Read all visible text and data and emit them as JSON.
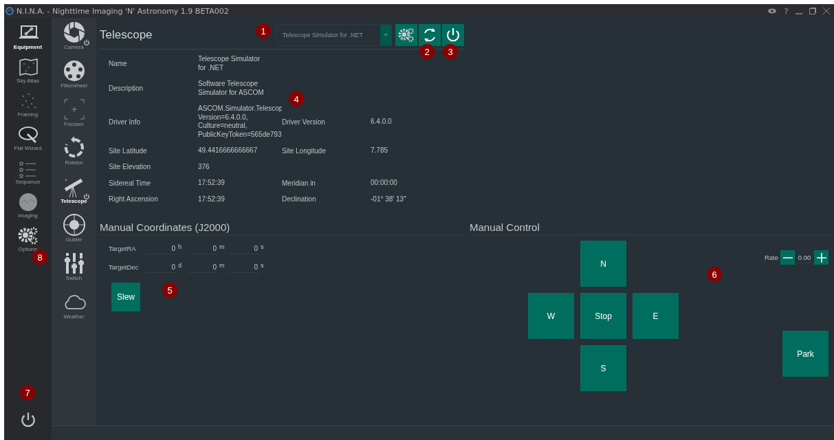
{
  "window": {
    "title": "N.I.N.A. - Nighttime Imaging 'N' Astronomy 1.9 BETA002",
    "help": "?"
  },
  "main_nav": [
    {
      "label": "Equipment",
      "selected": true
    },
    {
      "label": "Sky Atlas",
      "selected": false
    },
    {
      "label": "Framing",
      "selected": false
    },
    {
      "label": "Flat Wizard",
      "selected": false
    },
    {
      "label": "Sequence",
      "selected": false
    },
    {
      "label": "Imaging",
      "selected": false
    },
    {
      "label": "Options",
      "selected": false
    }
  ],
  "device_nav": [
    {
      "label": "Camera",
      "selected": false,
      "connected": true
    },
    {
      "label": "Filterwheel",
      "selected": false,
      "connected": false
    },
    {
      "label": "Focuser",
      "selected": false,
      "connected": false
    },
    {
      "label": "Rotator",
      "selected": false,
      "connected": false
    },
    {
      "label": "Telescope",
      "selected": true,
      "connected": true
    },
    {
      "label": "Guider",
      "selected": false,
      "connected": false
    },
    {
      "label": "Switch",
      "selected": false,
      "connected": false
    },
    {
      "label": "Weather",
      "selected": false,
      "connected": false
    }
  ],
  "telescope": {
    "title": "Telescope",
    "device_dropdown": {
      "value": "Telescope Simulator for .NET",
      "disabled": true
    },
    "info": [
      {
        "label": "Name",
        "value": [
          "Telescope Simulator",
          "for .NET"
        ]
      },
      {
        "label": "Description",
        "value": [
          "Software Telescope",
          "Simulator for ASCOM"
        ]
      },
      {
        "label": "Driver Info",
        "value": [
          "ASCOM.Simulator.Telescop",
          "Version=6.4.0.0,",
          "Culture=neutral,",
          "PublicKeyToken=565de793"
        ],
        "second": {
          "label": "Driver Version",
          "value": "6.4.0.0"
        }
      },
      {
        "label": "Site Latitude",
        "value": [
          "49.4416666666667"
        ],
        "second": {
          "label": "Site Longitude",
          "value": "7.785"
        }
      },
      {
        "label": "Site Elevation",
        "value": [
          "376"
        ]
      },
      {
        "label": "Sidereal Time",
        "value": [
          "17:52:39"
        ],
        "second": {
          "label": "Meridian in",
          "value": "00:00:00"
        }
      },
      {
        "label": "Right Ascension",
        "value": [
          "17:52:39"
        ],
        "second": {
          "label": "Declination",
          "value": "-01° 38' 13\""
        }
      }
    ]
  },
  "manual_coordinates": {
    "title": "Manual Coordinates (J2000)",
    "rows": [
      {
        "label": "TargetRA",
        "fields": [
          {
            "value": "0",
            "unit": "h"
          },
          {
            "value": "0",
            "unit": "m"
          },
          {
            "value": "0",
            "unit": "s"
          }
        ]
      },
      {
        "label": "TargetDec",
        "fields": [
          {
            "value": "0",
            "unit": "d"
          },
          {
            "value": "0",
            "unit": "m"
          },
          {
            "value": "0",
            "unit": "s"
          }
        ]
      }
    ],
    "slew": "Slew"
  },
  "manual_control": {
    "title": "Manual Control",
    "pad": [
      {
        "label": "N",
        "kind": "north"
      },
      {
        "label": "W",
        "kind": "west"
      },
      {
        "label": "Stop",
        "kind": "stop"
      },
      {
        "label": "E",
        "kind": "east"
      },
      {
        "label": "S",
        "kind": "south"
      }
    ],
    "rate": {
      "label": "Rate",
      "value": "0.00"
    },
    "park": "Park"
  },
  "callouts": [
    "1",
    "2",
    "3",
    "4",
    "5",
    "6",
    "7",
    "8"
  ]
}
